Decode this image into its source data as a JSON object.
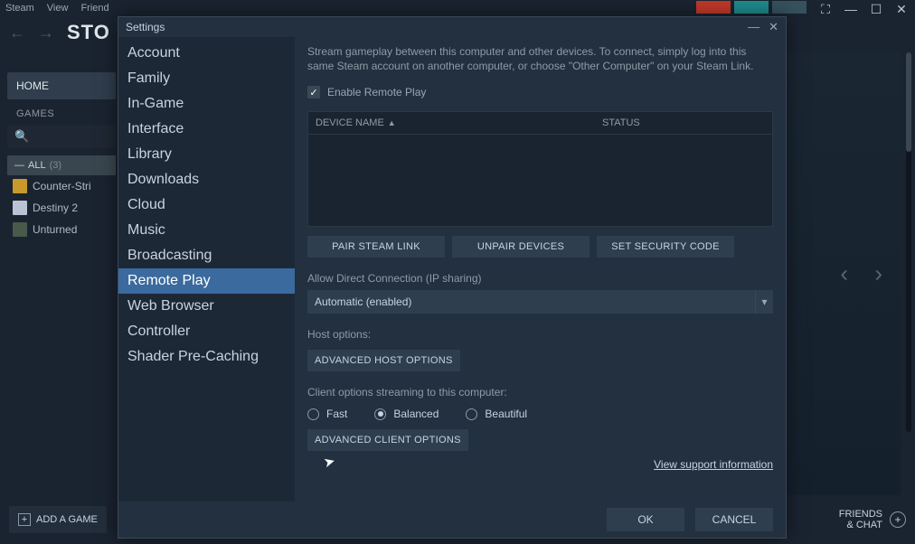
{
  "menu": {
    "steam": "Steam",
    "view": "View",
    "friends": "Friend"
  },
  "nav": {
    "store_title": "STO"
  },
  "sidebar": {
    "home": "HOME",
    "games": "GAMES",
    "all_label": "ALL",
    "all_count": "(3)",
    "items": [
      {
        "label": "Counter-Stri"
      },
      {
        "label": "Destiny 2"
      },
      {
        "label": "Unturned"
      }
    ]
  },
  "bottom": {
    "add_game": "ADD A GAME",
    "friends_chat_l1": "FRIENDS",
    "friends_chat_l2": "& CHAT"
  },
  "dialog": {
    "title": "Settings",
    "categories": [
      "Account",
      "Family",
      "In-Game",
      "Interface",
      "Library",
      "Downloads",
      "Cloud",
      "Music",
      "Broadcasting",
      "Remote Play",
      "Web Browser",
      "Controller",
      "Shader Pre-Caching"
    ],
    "selected_index": 9,
    "description": "Stream gameplay between this computer and other devices. To connect, simply log into this same Steam account on another computer, or choose \"Other Computer\" on your Steam Link.",
    "enable_label": "Enable Remote Play",
    "enable_checked": true,
    "table": {
      "col_device": "DEVICE NAME",
      "col_status": "STATUS"
    },
    "pair_btn": "PAIR STEAM LINK",
    "unpair_btn": "UNPAIR DEVICES",
    "security_btn": "SET SECURITY CODE",
    "direct_label": "Allow Direct Connection (IP sharing)",
    "direct_value": "Automatic (enabled)",
    "host_label": "Host options:",
    "adv_host_btn": "ADVANCED HOST OPTIONS",
    "client_label": "Client options streaming to this computer:",
    "quality": {
      "fast": "Fast",
      "balanced": "Balanced",
      "beautiful": "Beautiful",
      "selected": "balanced"
    },
    "adv_client_btn": "ADVANCED CLIENT OPTIONS",
    "support_link": "View support information",
    "ok": "OK",
    "cancel": "CANCEL"
  }
}
